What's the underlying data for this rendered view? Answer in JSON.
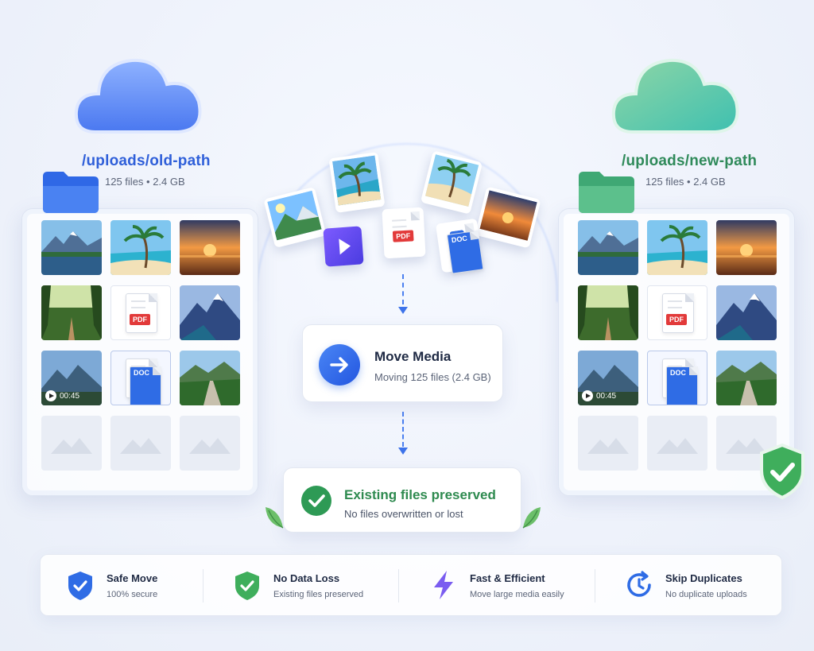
{
  "source": {
    "path": "/uploads/old-path",
    "meta": "125 files • 2.4 GB",
    "color": "#2f5fd9"
  },
  "destination": {
    "path": "/uploads/new-path",
    "meta": "125 files • 2.4 GB",
    "color": "#2f8a5a"
  },
  "grid_items": [
    {
      "kind": "image",
      "icon": "mountain-lake-thumbnail"
    },
    {
      "kind": "image",
      "icon": "beach-palm-thumbnail"
    },
    {
      "kind": "image",
      "icon": "sunset-thumbnail"
    },
    {
      "kind": "image",
      "icon": "forest-path-thumbnail"
    },
    {
      "kind": "file",
      "label": "PDF"
    },
    {
      "kind": "image",
      "icon": "snow-mountain-thumbnail"
    },
    {
      "kind": "video",
      "icon": "mountain-video-thumbnail",
      "duration": "00:45"
    },
    {
      "kind": "file",
      "label": "DOC"
    },
    {
      "kind": "image",
      "icon": "valley-road-thumbnail"
    },
    {
      "kind": "placeholder"
    },
    {
      "kind": "placeholder"
    },
    {
      "kind": "placeholder"
    }
  ],
  "flying": {
    "pdf_label": "PDF",
    "doc_label": "DOC"
  },
  "move": {
    "title": "Move Media",
    "subtitle": "Moving 125 files (2.4 GB)",
    "button_icon": "arrow-right-icon"
  },
  "preserved": {
    "title": "Existing files preserved",
    "subtitle": "No files overwritten or lost"
  },
  "features": [
    {
      "title": "Safe Move",
      "subtitle": "100% secure",
      "icon": "shield-check-icon"
    },
    {
      "title": "No Data Loss",
      "subtitle": "Existing files preserved",
      "icon": "shield-check-green-icon"
    },
    {
      "title": "Fast & Efficient",
      "subtitle": "Move large media easily",
      "icon": "lightning-icon"
    },
    {
      "title": "Skip Duplicates",
      "subtitle": "No duplicate uploads",
      "icon": "clock-arrow-icon"
    }
  ],
  "colors": {
    "accent": "#2f6ce5",
    "success": "#2e9a55",
    "danger": "#e23a3a"
  }
}
